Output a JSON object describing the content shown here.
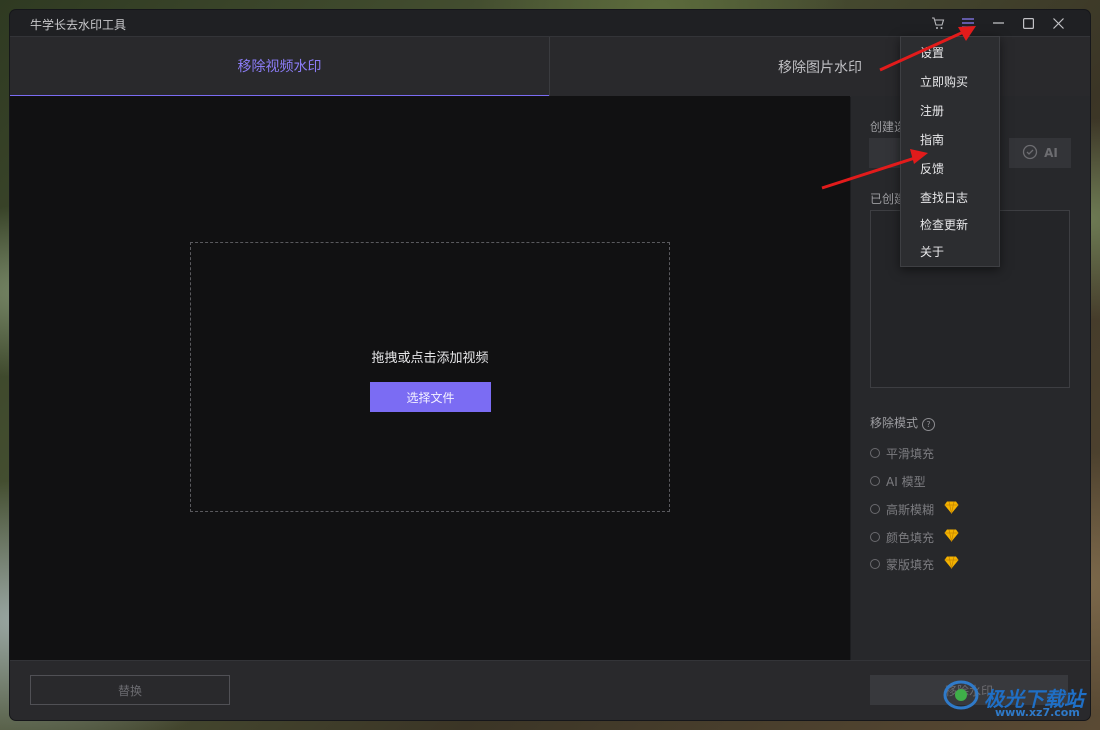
{
  "window": {
    "title": "牛学长去水印工具"
  },
  "titlebar_icons": [
    "cart-icon",
    "menu-icon",
    "minimize-icon",
    "maximize-icon",
    "close-icon"
  ],
  "tabs": [
    {
      "label": "移除视频水印",
      "active": true
    },
    {
      "label": "移除图片水印",
      "active": false
    }
  ],
  "canvas": {
    "drop_text": "拖拽或点击添加视频",
    "select_button": "选择文件"
  },
  "side": {
    "create_label": "创建选",
    "ai_button": "AI",
    "created_label": "已创建",
    "mode_label": "移除模式",
    "modes": [
      {
        "label": "平滑填充",
        "premium": false
      },
      {
        "label": "AI 模型",
        "premium": false
      },
      {
        "label": "高斯模糊",
        "premium": true
      },
      {
        "label": "颜色填充",
        "premium": true
      },
      {
        "label": "蒙版填充",
        "premium": true
      }
    ]
  },
  "bottom": {
    "replace_button": "替换",
    "remove_button": "移除水印"
  },
  "menu": {
    "items": [
      "设置",
      "立即购买",
      "注册",
      "指南",
      "反馈",
      "查找日志",
      "检查更新",
      "关于"
    ]
  },
  "watermark": {
    "name": "极光下载站",
    "url": "www.xz7.com"
  },
  "colors": {
    "accent": "#7b6cf3",
    "annotation_arrow": "#e21b1b",
    "gem": "#f5b300"
  }
}
